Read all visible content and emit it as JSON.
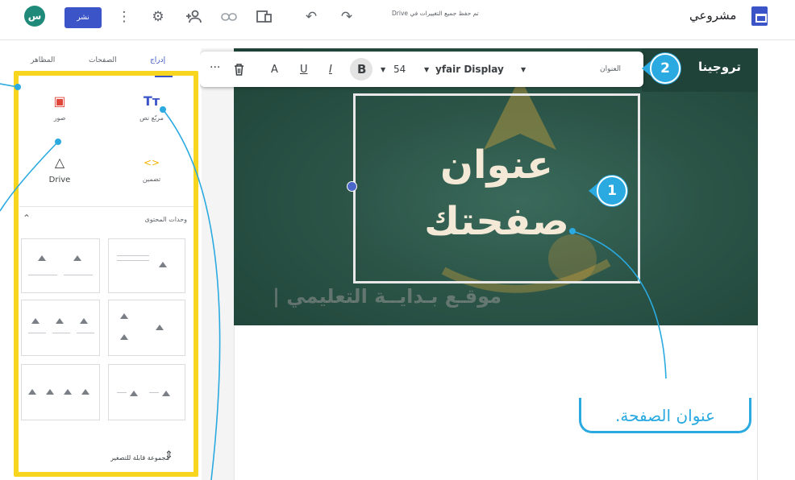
{
  "topbar": {
    "avatar_initial": "س",
    "publish_label": "نشر",
    "saved_message": "تم حفظ جميع التغييرات في Drive",
    "doc_title": "مشروعي",
    "icons": [
      "more-vert-icon",
      "settings-icon",
      "add-person-icon",
      "link-icon",
      "preview-icon",
      "undo-icon",
      "redo-icon",
      "sites-logo-icon"
    ]
  },
  "panel": {
    "tabs": [
      "إدراج",
      "الصفحات",
      "المظاهر"
    ],
    "active_tab": "إدراج",
    "insert_items": [
      {
        "label": "مربّع نص",
        "icon": "Tт"
      },
      {
        "label": "صور",
        "icon": "▣"
      },
      {
        "label": "تضمين",
        "icon": "<>"
      },
      {
        "label": "Drive",
        "icon": "△"
      }
    ],
    "content_blocks_label": "وحدات المحتوى",
    "collapsible_group_label": "مجموعة قابلة للتصغير"
  },
  "format_bar": {
    "style_value": "العنوان",
    "font_value": "yfair Display",
    "size_value": "54",
    "bold": "B",
    "italic": "I",
    "underline": "U",
    "text_color": "A"
  },
  "site": {
    "name": "تروجينا",
    "page_title_line1": "عنوان",
    "page_title_line2": "صفحتك"
  },
  "callouts": {
    "one": "1",
    "two": "2",
    "page_title_label": "عنوان الصفحة."
  },
  "watermark": {
    "text": "موقـع بـدايــة التعليمي |"
  },
  "colors": {
    "accent": "#3b55c9",
    "callout": "#2aaae0",
    "frame": "#f8d51f",
    "header_bg": "#2b5447"
  }
}
